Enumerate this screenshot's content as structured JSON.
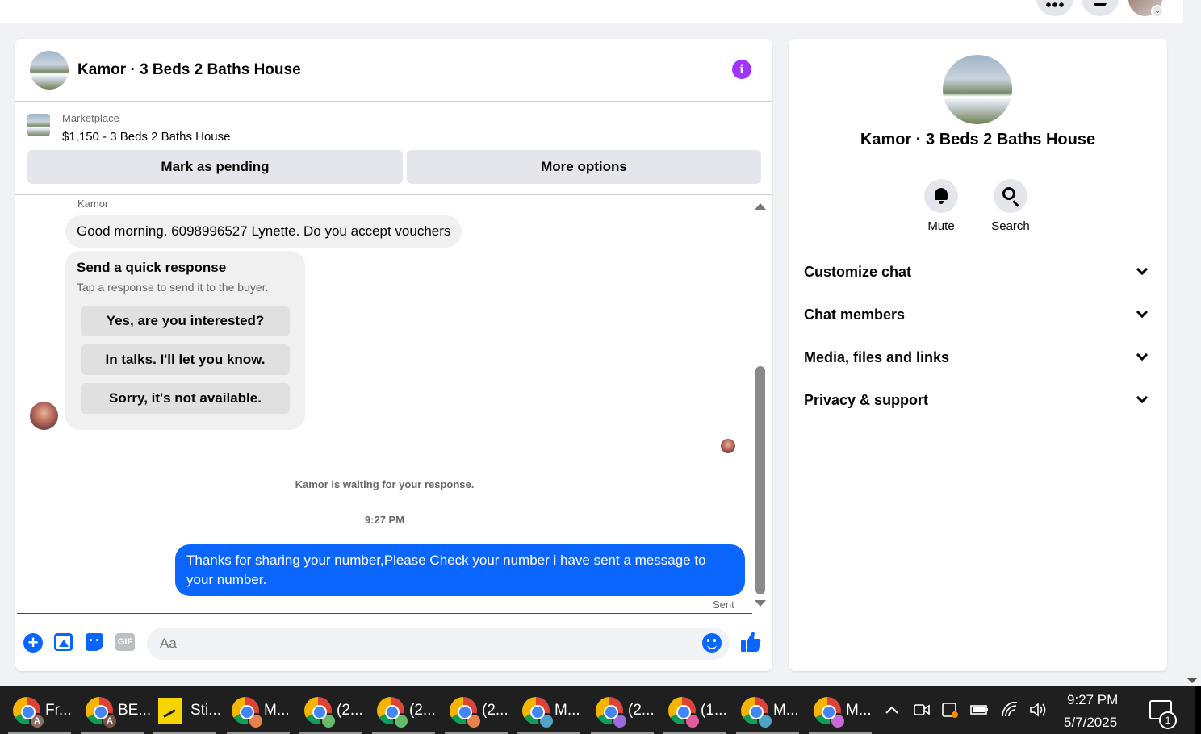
{
  "chat": {
    "title": "Kamor · 3 Beds 2 Baths House",
    "marketplace_label": "Marketplace",
    "listing": "$1,150 - 3 Beds 2 Baths House",
    "mark_pending_label": "Mark as pending",
    "more_options_label": "More options",
    "sender_name": "Kamor",
    "incoming_message": "Good morning. 6098996527 Lynette. Do you accept vouchers",
    "quick_response": {
      "title": "Send a quick response",
      "subtitle": "Tap a response to send it to the buyer.",
      "options": [
        "Yes, are you interested?",
        "In talks. I'll let you know.",
        "Sorry, it's not available."
      ]
    },
    "waiting_text": "Kamor is waiting for your response.",
    "timestamp": "9:27 PM",
    "outgoing_message": "Thanks for sharing your number,Please Check your number i have sent a message to your number.",
    "sent_label": "Sent",
    "composer": {
      "placeholder": "Aa",
      "gif_label": "GIF"
    },
    "accent_color": "#0a66ff"
  },
  "info_panel": {
    "title": "Kamor · 3 Beds 2 Baths House",
    "actions": [
      {
        "label": "Mute",
        "icon": "bell-icon"
      },
      {
        "label": "Search",
        "icon": "search-icon"
      }
    ],
    "sections": [
      "Customize chat",
      "Chat members",
      "Media, files and links",
      "Privacy & support"
    ]
  },
  "taskbar": {
    "items": [
      {
        "label": "Fr...",
        "icon": "chrome-icon",
        "profile": "A",
        "profile_color": "#8d6e63"
      },
      {
        "label": "BE...",
        "icon": "chrome-icon",
        "profile": "A",
        "profile_color": "#795548"
      },
      {
        "label": "Sti...",
        "icon": "sticky-notes-icon"
      },
      {
        "label": "M...",
        "icon": "chrome-icon",
        "profile_color": "#e8824a"
      },
      {
        "label": "(2...",
        "icon": "chrome-icon",
        "profile_color": "#66bb6a"
      },
      {
        "label": "(2...",
        "icon": "chrome-icon",
        "profile_color": "#66bb6a"
      },
      {
        "label": "(2...",
        "icon": "chrome-icon",
        "profile_color": "#e8824a"
      },
      {
        "label": "M...",
        "icon": "chrome-icon",
        "profile_color": "#4fa3c7"
      },
      {
        "label": "(2...",
        "icon": "chrome-icon",
        "profile_color": "#9c6ade"
      },
      {
        "label": "(1...",
        "icon": "chrome-icon",
        "profile_color": "#e25c9c"
      },
      {
        "label": "M...",
        "icon": "chrome-icon",
        "profile_color": "#4fa3c7"
      },
      {
        "label": "M...",
        "icon": "chrome-icon",
        "profile_color": "#c86bd6"
      }
    ],
    "clock_time": "9:27 PM",
    "clock_date": "5/7/2025",
    "notification_count": "1"
  }
}
